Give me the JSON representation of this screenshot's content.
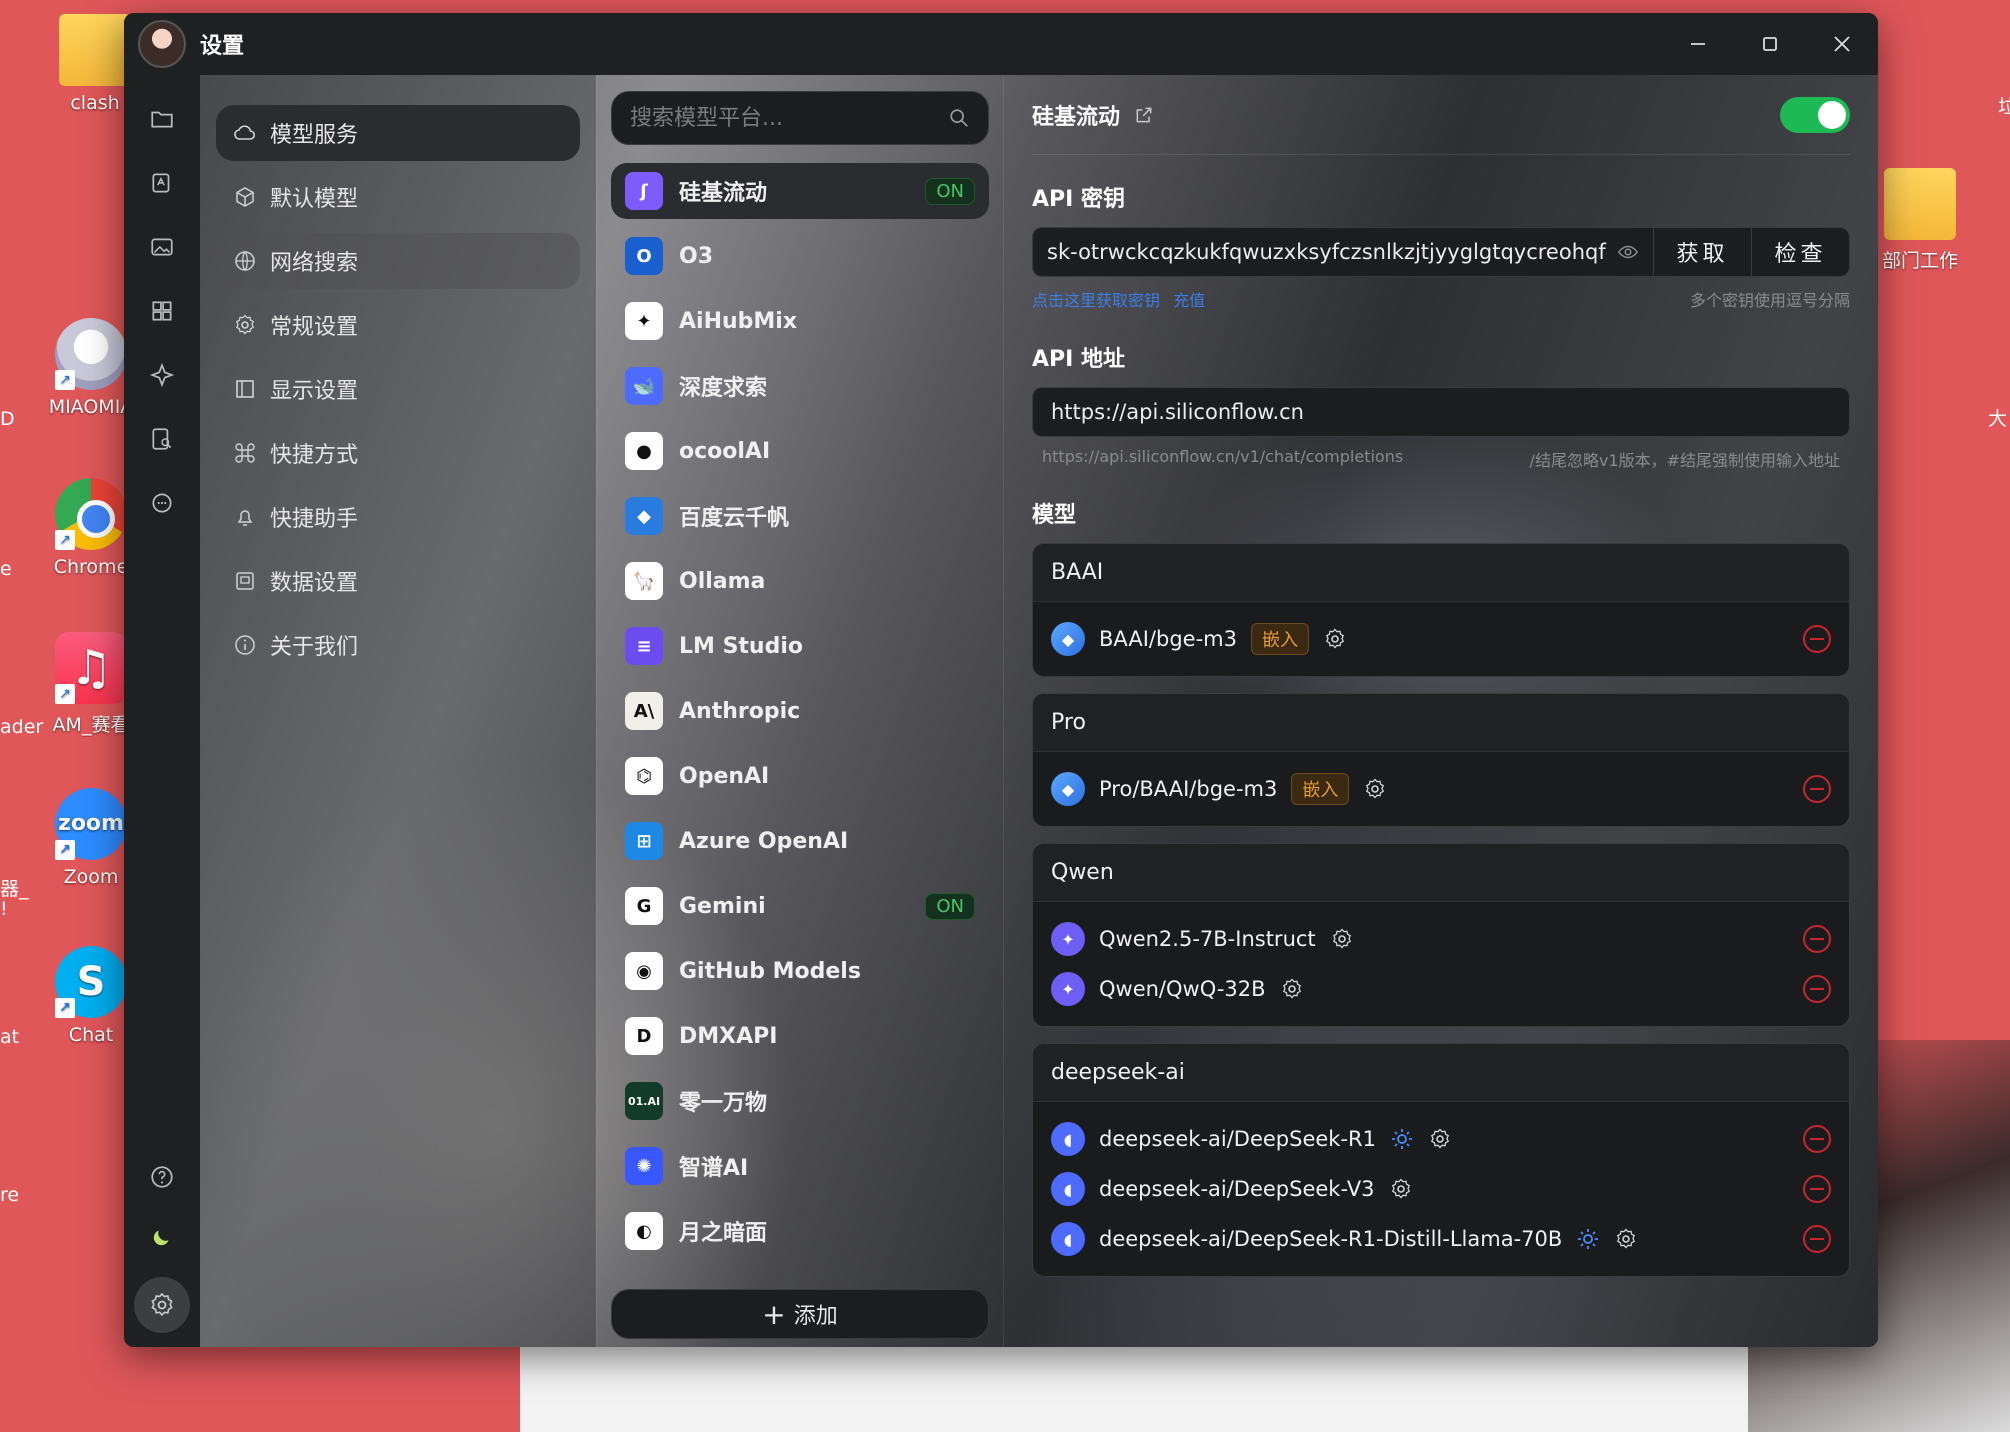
{
  "desktop": {
    "icons": [
      {
        "label": "clash",
        "kind": "folder"
      },
      {
        "label": "MIAOMIA",
        "kind": "anime"
      },
      {
        "label": "Chrome",
        "kind": "chrome"
      },
      {
        "label": "AM_赛看",
        "kind": "music"
      },
      {
        "label": "Zoom",
        "kind": "zoom"
      },
      {
        "label": "Chat",
        "kind": "skype"
      },
      {
        "label": "部门工作",
        "kind": "folder"
      }
    ],
    "left_edge_labels": [
      "D",
      "e",
      "ader",
      "器_",
      "!",
      "at",
      "re"
    ],
    "right_edge_labels": [
      "垃",
      "大"
    ]
  },
  "window": {
    "title": "设置",
    "controls": {
      "minimize": "—",
      "maximize": "☐",
      "close": "✕"
    }
  },
  "rail": {
    "icons": [
      "folder-icon",
      "assistant-icon",
      "image-icon",
      "apps-icon",
      "sparkle-icon",
      "document-search-icon",
      "chat-icon"
    ],
    "bottom": [
      "help-icon",
      "moon-icon",
      "settings-icon"
    ]
  },
  "nav": {
    "items": [
      {
        "label": "模型服务",
        "icon": "cloud-icon",
        "state": "active"
      },
      {
        "label": "默认模型",
        "icon": "cube-icon",
        "state": ""
      },
      {
        "label": "网络搜索",
        "icon": "globe-icon",
        "state": "hover"
      },
      {
        "label": "常规设置",
        "icon": "gear-icon",
        "state": ""
      },
      {
        "label": "显示设置",
        "icon": "layout-icon",
        "state": ""
      },
      {
        "label": "快捷方式",
        "icon": "command-icon",
        "state": ""
      },
      {
        "label": "快捷助手",
        "icon": "bell-icon",
        "state": ""
      },
      {
        "label": "数据设置",
        "icon": "database-icon",
        "state": ""
      },
      {
        "label": "关于我们",
        "icon": "info-icon",
        "state": ""
      }
    ]
  },
  "providers": {
    "search_placeholder": "搜索模型平台...",
    "items": [
      {
        "name": "硅基流动",
        "on": true,
        "active": true,
        "logo_text": "ʃ",
        "logo_bg": "#7c5cff"
      },
      {
        "name": "O3",
        "on": false,
        "logo_text": "O",
        "logo_bg": "#1a5fd0"
      },
      {
        "name": "AiHubMix",
        "on": false,
        "logo_text": "✦",
        "logo_bg": "#ffffff"
      },
      {
        "name": "深度求索",
        "on": false,
        "logo_text": "🐋",
        "logo_bg": "#4d6bfe"
      },
      {
        "name": "ocoolAI",
        "on": false,
        "logo_text": "●",
        "logo_bg": "#ffffff"
      },
      {
        "name": "百度云千帆",
        "on": false,
        "logo_text": "◆",
        "logo_bg": "#2a7bdf"
      },
      {
        "name": "Ollama",
        "on": false,
        "logo_text": "🦙",
        "logo_bg": "#ffffff"
      },
      {
        "name": "LM Studio",
        "on": false,
        "logo_text": "≡",
        "logo_bg": "#6a4cf0"
      },
      {
        "name": "Anthropic",
        "on": false,
        "logo_text": "A\\",
        "logo_bg": "#f0efe9"
      },
      {
        "name": "OpenAI",
        "on": false,
        "logo_text": "⌬",
        "logo_bg": "#ffffff"
      },
      {
        "name": "Azure OpenAI",
        "on": false,
        "logo_text": "⊞",
        "logo_bg": "#1e88e5"
      },
      {
        "name": "Gemini",
        "on": true,
        "logo_text": "G",
        "logo_bg": "#ffffff"
      },
      {
        "name": "GitHub Models",
        "on": false,
        "logo_text": "◉",
        "logo_bg": "#ffffff"
      },
      {
        "name": "DMXAPI",
        "on": false,
        "logo_text": "D",
        "logo_bg": "#ffffff"
      },
      {
        "name": "零一万物",
        "on": false,
        "logo_text": "01.AI",
        "logo_bg": "#123b2c"
      },
      {
        "name": "智谱AI",
        "on": false,
        "logo_text": "✺",
        "logo_bg": "#3857ff"
      },
      {
        "name": "月之暗面",
        "on": false,
        "logo_text": "◐",
        "logo_bg": "#ffffff"
      }
    ],
    "on_label": "ON",
    "add_label": "添加"
  },
  "detail": {
    "provider_name": "硅基流动",
    "enabled": true,
    "api_key": {
      "label": "API 密钥",
      "value": "sk-otrwckcqzkukfqwuzxksyfczsnlkzjtjyyglgtqycreohqfo,sk",
      "get_label": "获取",
      "check_label": "检查",
      "hint_link": "点击这里获取密钥",
      "hint_recharge": "充值",
      "hint_right": "多个密钥使用逗号分隔"
    },
    "api_url": {
      "label": "API 地址",
      "value": "https://api.siliconflow.cn",
      "hint_left": "https://api.siliconflow.cn/v1/chat/completions",
      "hint_right": "/结尾忽略v1版本，#结尾强制使用输入地址"
    },
    "models_label": "模型",
    "groups": [
      {
        "name": "BAAI",
        "models": [
          {
            "id": "BAAI/bge-m3",
            "tag": "嵌入",
            "reasoning": false,
            "logo": "bge"
          }
        ]
      },
      {
        "name": "Pro",
        "models": [
          {
            "id": "Pro/BAAI/bge-m3",
            "tag": "嵌入",
            "reasoning": false,
            "logo": "bge"
          }
        ]
      },
      {
        "name": "Qwen",
        "models": [
          {
            "id": "Qwen2.5-7B-Instruct",
            "tag": "",
            "reasoning": false,
            "logo": "qwen"
          },
          {
            "id": "Qwen/QwQ-32B",
            "tag": "",
            "reasoning": false,
            "logo": "qwen"
          }
        ]
      },
      {
        "name": "deepseek-ai",
        "models": [
          {
            "id": "deepseek-ai/DeepSeek-R1",
            "tag": "",
            "reasoning": true,
            "logo": "deepseek"
          },
          {
            "id": "deepseek-ai/DeepSeek-V3",
            "tag": "",
            "reasoning": false,
            "logo": "deepseek"
          },
          {
            "id": "deepseek-ai/DeepSeek-R1-Distill-Llama-70B",
            "tag": "",
            "reasoning": true,
            "logo": "deepseek"
          }
        ]
      }
    ]
  },
  "colors": {
    "accent_green": "#1db954",
    "on_badge_text": "#48c56b",
    "embed_tag": "#e49c3c",
    "remove_red": "#c8262e",
    "link_blue": "#3d7de6",
    "desktop_bg": "#e0575a"
  }
}
